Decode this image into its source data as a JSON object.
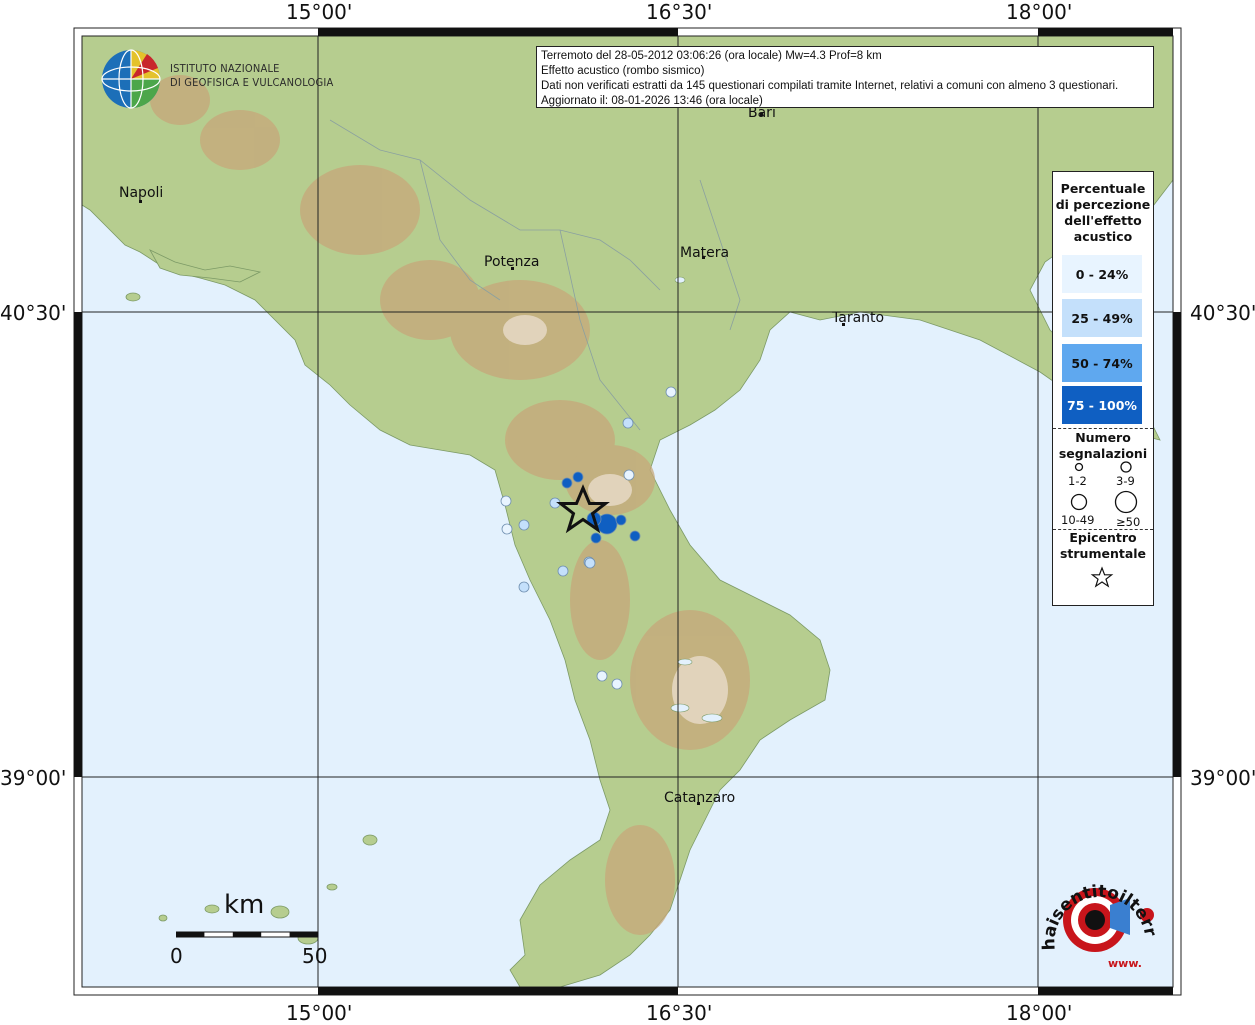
{
  "header": {
    "quake_line": "Terremoto del 28-05-2012 03:06:26 (ora locale) Mw=4.3 Prof=8 km",
    "effect_line": "Effetto acustico (rombo sismico)",
    "data_line": "Dati non verificati estratti da 145 questionari compilati tramite Internet, relativi a comuni con almeno 3 questionari.",
    "updated_line": "Aggiornato il: 08-01-2026 13:46 (ora locale)"
  },
  "institute": {
    "line1": "ISTITUTO NAZIONALE",
    "line2": "DI GEOFISICA E VULCANOLOGIA"
  },
  "coords": {
    "top": [
      "15°00'",
      "16°30'",
      "18°00'"
    ],
    "bottom": [
      "15°00'",
      "16°30'",
      "18°00'"
    ],
    "left": [
      "40°30'",
      "39°00'"
    ],
    "right": [
      "40°30'",
      "39°00'"
    ]
  },
  "cities": [
    "Napoli",
    "Potenza",
    "Matera",
    "Bari",
    "Taranto",
    "Catanzaro"
  ],
  "legend": {
    "title": [
      "Percentuale",
      "di percezione",
      "dell'effetto",
      "acustico"
    ],
    "classes": [
      {
        "label": "0 - 24%",
        "color": "#e8f4ff",
        "text_color": "#111111"
      },
      {
        "label": "25 - 49%",
        "color": "#c4e0fb",
        "text_color": "#111111"
      },
      {
        "label": "50 - 74%",
        "color": "#5fa8ef",
        "text_color": "#111111"
      },
      {
        "label": "75 - 100%",
        "color": "#0f5fc2",
        "text_color": "#ffffff"
      }
    ],
    "count_title": [
      "Numero",
      "segnalazioni"
    ],
    "sizes": [
      "1-2",
      "3-9",
      "10-49",
      "≥50"
    ],
    "epicenter_title": [
      "Epicentro",
      "strumentale"
    ]
  },
  "scale_bar": {
    "unit": "km",
    "start": "0",
    "end": "50"
  },
  "site_logo": {
    "text": "haisentitoilterremoto.it",
    "prefix": "www."
  },
  "points": [
    {
      "pct": "0-24",
      "size": "1-2"
    },
    {
      "pct": "25-49",
      "size": "1-2"
    },
    {
      "pct": "0-24",
      "size": "1-2"
    },
    {
      "pct": "75-100",
      "size": "1-2"
    },
    {
      "pct": "75-100",
      "size": "1-2"
    },
    {
      "pct": "25-49",
      "size": "1-2"
    },
    {
      "pct": "0-24",
      "size": "1-2"
    },
    {
      "pct": "0-24",
      "size": "1-2"
    },
    {
      "pct": "25-49",
      "size": "1-2"
    },
    {
      "pct": "75-100",
      "size": "≥50"
    },
    {
      "pct": "75-100",
      "size": "3-9"
    },
    {
      "pct": "75-100",
      "size": "1-2"
    },
    {
      "pct": "75-100",
      "size": "1-2"
    },
    {
      "pct": "75-100",
      "size": "1-2"
    },
    {
      "pct": "25-49",
      "size": "1-2"
    },
    {
      "pct": "25-49",
      "size": "1-2"
    },
    {
      "pct": "25-49",
      "size": "1-2"
    },
    {
      "pct": "0-24",
      "size": "1-2"
    },
    {
      "pct": "0-24",
      "size": "1-2"
    },
    {
      "pct": "25-49",
      "size": "1-2"
    }
  ]
}
